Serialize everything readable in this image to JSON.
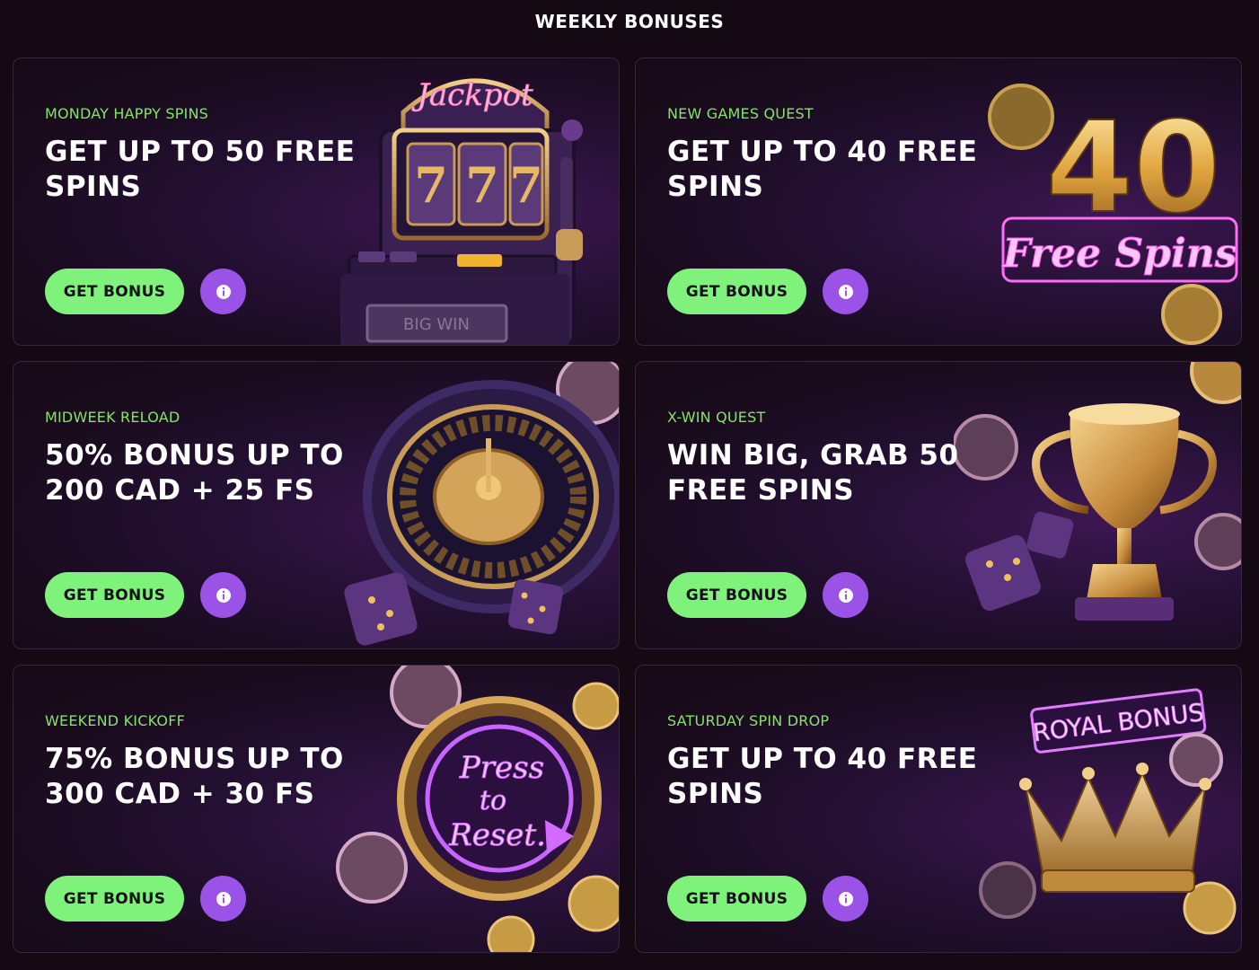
{
  "page": {
    "title": "WEEKLY BONUSES"
  },
  "cards": [
    {
      "tag": "MONDAY HAPPY SPINS",
      "title": "GET UP TO 50 FREE SPINS",
      "button_label": "GET BONUS",
      "art": {
        "top_sign": "Jackpot",
        "reels": [
          "7",
          "7",
          "7"
        ],
        "plate": "BIG WIN"
      }
    },
    {
      "tag": "NEW GAMES QUEST",
      "title": "GET UP TO 40 FREE SPINS",
      "button_label": "GET BONUS",
      "art": {
        "big_number": "40",
        "neon": "Free Spins"
      }
    },
    {
      "tag": "MIDWEEK RELOAD",
      "title": "50% BONUS UP TO 200 CAD + 25 FS",
      "button_label": "GET BONUS",
      "art": {}
    },
    {
      "tag": "X-WIN QUEST",
      "title": "WIN BIG, GRAB 50 FREE SPINS",
      "button_label": "GET BONUS",
      "art": {}
    },
    {
      "tag": "WEEKEND KICKOFF",
      "title": "75% BONUS UP TO 300 CAD + 30 FS",
      "button_label": "GET BONUS",
      "art": {
        "neon_line1": "Press",
        "neon_line2": "to",
        "neon_line3": "Reset."
      }
    },
    {
      "tag": "SATURDAY SPIN DROP",
      "title": "GET UP TO 40 FREE SPINS",
      "button_label": "GET BONUS",
      "art": {
        "neon_sign": "ROYAL BONUS"
      }
    }
  ],
  "icons": {
    "info": "info-icon"
  },
  "colors": {
    "accent_green": "#7ef27a",
    "tag_green": "#86e36a",
    "info_purple": "#9b52e6",
    "background": "#150a14"
  }
}
